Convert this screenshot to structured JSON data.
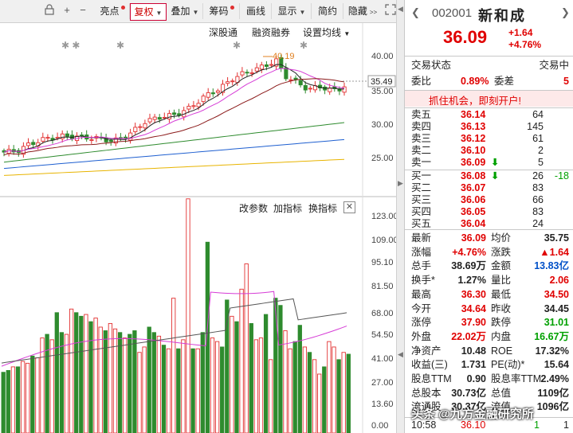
{
  "toolbar": {
    "lock_icon": "lock-icon",
    "plus_label": "+",
    "minus_label": "−",
    "hl_label": "亮点",
    "fq_label": "复权",
    "dj_label": "叠加",
    "cm_label": "筹码",
    "qx_label": "画线",
    "xs_label": "显示",
    "jy_label": "简约",
    "yc_label": "隐藏",
    "expand_icon": "fullscreen-icon"
  },
  "main_chart": {
    "shendu_label": "深股通",
    "rzrq_label": "融资融券",
    "setting_label": "设置均线",
    "high_marker": "40.19",
    "current_price_tag": "35.49",
    "y_ticks": [
      "40.00",
      "35.00",
      "30.00",
      "25.00"
    ],
    "colors": {
      "up": "#e23030",
      "down": "#2e8b2e",
      "ma5": "#222222",
      "ma10": "#d63cd6",
      "ma20": "#8b1a1a",
      "ma30": "#2e8b2e",
      "ma60": "#1e5fd0",
      "ma120": "#e8b400"
    }
  },
  "volume_chart": {
    "gaicanshu_label": "改参数",
    "jiazhibiao_label": "加指标",
    "huanzhibiao_label": "换指标",
    "close_icon": "close-icon",
    "y_ticks": [
      "123.00",
      "109.00",
      "95.10",
      "81.50",
      "68.00",
      "54.50",
      "41.00",
      "27.00",
      "13.60",
      "0.00"
    ]
  },
  "quote": {
    "code": "002001",
    "name": "新和成",
    "price": "36.09",
    "change": "+1.64",
    "change_pct": "+4.76%",
    "status_label": "交易状态",
    "status_value": "交易中",
    "wb_label": "委比",
    "wb_value": "0.89%",
    "wc_label": "委差",
    "wc_value": "5",
    "promo": "抓住机会，即刻开户!",
    "asks": [
      {
        "label": "卖五",
        "price": "36.14",
        "vol": "64"
      },
      {
        "label": "卖四",
        "price": "36.13",
        "vol": "145"
      },
      {
        "label": "卖三",
        "price": "36.12",
        "vol": "61"
      },
      {
        "label": "卖二",
        "price": "36.10",
        "vol": "2"
      },
      {
        "label": "卖一",
        "price": "36.09",
        "vol": "5"
      }
    ],
    "bids": [
      {
        "label": "买一",
        "price": "36.08",
        "vol": "26",
        "extra": "-18"
      },
      {
        "label": "买二",
        "price": "36.07",
        "vol": "83",
        "extra": ""
      },
      {
        "label": "买三",
        "price": "36.06",
        "vol": "66",
        "extra": ""
      },
      {
        "label": "买四",
        "price": "36.05",
        "vol": "83",
        "extra": ""
      },
      {
        "label": "买五",
        "price": "36.04",
        "vol": "24",
        "extra": ""
      }
    ],
    "stats": [
      {
        "l1": "最新",
        "v1": "36.09",
        "c1": "red",
        "l2": "均价",
        "v2": "35.75",
        "c2": "black"
      },
      {
        "l1": "涨幅",
        "v1": "+4.76%",
        "c1": "red",
        "l2": "涨跌",
        "v2": "▲1.64",
        "c2": "red"
      },
      {
        "l1": "总手",
        "v1": "38.69万",
        "c1": "black",
        "l2": "金额",
        "v2": "13.83亿",
        "c2": "blue"
      },
      {
        "l1": "换手*",
        "v1": "1.27%",
        "c1": "black",
        "l2": "量比",
        "v2": "2.06",
        "c2": "red"
      },
      {
        "l1": "最高",
        "v1": "36.30",
        "c1": "red",
        "l2": "最低",
        "v2": "34.50",
        "c2": "red"
      },
      {
        "l1": "今开",
        "v1": "34.64",
        "c1": "red",
        "l2": "昨收",
        "v2": "34.45",
        "c2": "black"
      },
      {
        "l1": "涨停",
        "v1": "37.90",
        "c1": "red",
        "l2": "跌停",
        "v2": "31.01",
        "c2": "green"
      },
      {
        "l1": "外盘",
        "v1": "22.02万",
        "c1": "red",
        "l2": "内盘",
        "v2": "16.67万",
        "c2": "green"
      },
      {
        "l1": "净资产",
        "v1": "10.48",
        "c1": "black",
        "l2": "ROE",
        "v2": "17.32%",
        "c2": "black"
      },
      {
        "l1": "收益(三)",
        "v1": "1.731",
        "c1": "black",
        "l2": "PE(动)*",
        "v2": "15.64",
        "c2": "black"
      },
      {
        "l1": "股息TTM",
        "v1": "0.90",
        "c1": "black",
        "l2": "股息率TTM",
        "v2": "2.49%",
        "c2": "black"
      },
      {
        "l1": "总股本",
        "v1": "30.73亿",
        "c1": "black",
        "l2": "总值",
        "v2": "1109亿",
        "c2": "black"
      },
      {
        "l1": "流通股",
        "v1": "30.37亿",
        "c1": "black",
        "l2": "流值",
        "v2": "1096亿",
        "c2": "black"
      }
    ],
    "tick": {
      "time": "10:58",
      "price": "36.10",
      "vol": "1",
      "dir": "1"
    },
    "watermark": "头条 @九方金融研究所"
  }
}
